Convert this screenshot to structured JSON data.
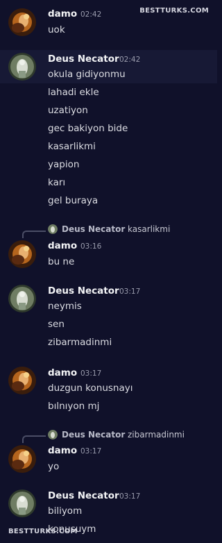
{
  "watermark": {
    "top": "BESTTURKS.COM",
    "bottom": "BESTTURKS.COM"
  },
  "messages": [
    {
      "author": "damo",
      "time": "02:42",
      "lines": [
        "uok"
      ]
    },
    {
      "author": "Deus Necator",
      "time": "02:42",
      "lines": [
        "okula gidiyonmu",
        "lahadi ekle",
        "uzatiyon",
        "gec bakiyon bide",
        "kasarlikmi",
        "yapion",
        "karı",
        "gel buraya"
      ]
    },
    {
      "author": "damo",
      "time": "03:16",
      "reply": {
        "author": "Deus Necator",
        "text": "kasarlikmi"
      },
      "lines": [
        "bu ne"
      ]
    },
    {
      "author": "Deus Necator",
      "time": "03:17",
      "lines": [
        "neymis",
        "sen",
        "zibarmadinmi"
      ]
    },
    {
      "author": "damo",
      "time": "03:17",
      "lines": [
        "duzgun konusnayı",
        "bılnıyon mj"
      ]
    },
    {
      "author": "damo",
      "time": "03:17",
      "reply": {
        "author": "Deus Necator",
        "text": "zibarmadinmi"
      },
      "lines": [
        "yo"
      ]
    },
    {
      "author": "Deus Necator",
      "time": "03:17",
      "lines": [
        "biliyom",
        "konusuym"
      ]
    }
  ]
}
